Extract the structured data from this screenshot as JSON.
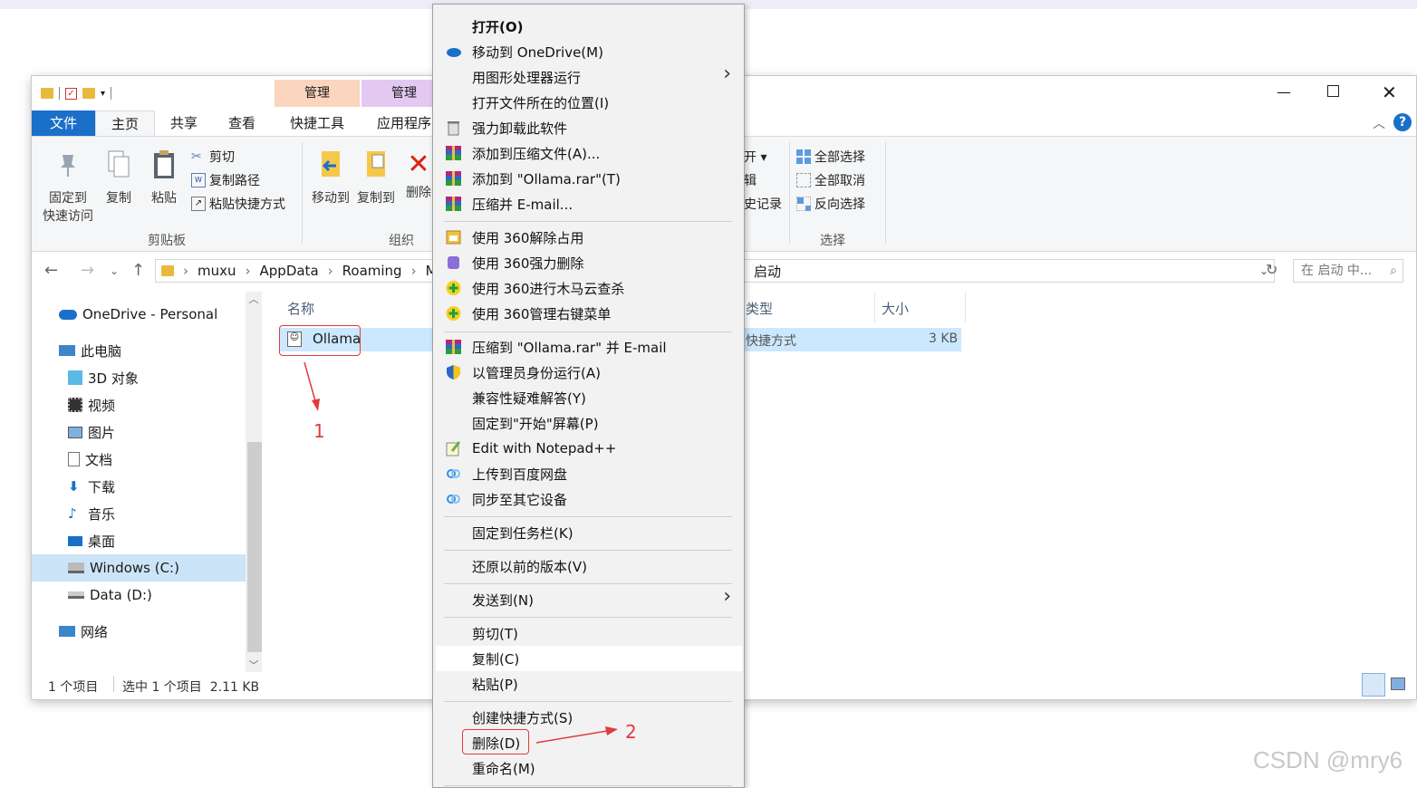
{
  "explorer": {
    "context_tabs": [
      "管理",
      "管理"
    ],
    "tabs": {
      "file": "文件",
      "home": "主页",
      "share": "共享",
      "view": "查看",
      "shortcut_tools": "快捷工具",
      "app_tools": "应用程序"
    },
    "ribbon": {
      "pin": [
        "固定到",
        "快速访问"
      ],
      "copy": "复制",
      "paste": "粘贴",
      "cut": "剪切",
      "copy_path": "复制路径",
      "paste_shortcut": "粘贴快捷方式",
      "clipboard_group": "剪贴板",
      "move_to": "移动到",
      "copy_to": "复制到",
      "delete": "删除",
      "organize_group": "组织",
      "open_partial": "开 ▾",
      "edit_partial": "辑",
      "history_partial": "史记录",
      "select_all": "全部选择",
      "select_none": "全部取消",
      "invert": "反向选择",
      "select_group": "选择"
    },
    "address": {
      "crumbs": [
        "muxu",
        "AppData",
        "Roaming",
        "M"
      ],
      "current": "启动",
      "search_placeholder": "在 启动 中..."
    },
    "nav": [
      "OneDrive - Personal",
      "此电脑",
      "3D 对象",
      "视频",
      "图片",
      "文档",
      "下载",
      "音乐",
      "桌面",
      "Windows (C:)",
      "Data (D:)",
      "网络"
    ],
    "columns": {
      "name": "名称",
      "type": "类型",
      "size": "大小"
    },
    "file": {
      "name": "Ollama",
      "type": "快捷方式",
      "size": "3 KB"
    },
    "status": {
      "count": "1 个项目",
      "selected": "选中 1 个项目  2.11 KB"
    }
  },
  "menu": {
    "items": [
      "打开(O)",
      "移动到 OneDrive(M)",
      "用图形处理器运行",
      "打开文件所在的位置(I)",
      "强力卸载此软件",
      "添加到压缩文件(A)...",
      "添加到 \"Ollama.rar\"(T)",
      "压缩并 E-mail...",
      "使用 360解除占用",
      "使用 360强力删除",
      "使用 360进行木马云查杀",
      "使用 360管理右键菜单",
      "压缩到 \"Ollama.rar\" 并 E-mail",
      "以管理员身份运行(A)",
      "兼容性疑难解答(Y)",
      "固定到\"开始\"屏幕(P)",
      "Edit with Notepad++",
      "上传到百度网盘",
      "同步至其它设备",
      "固定到任务栏(K)",
      "还原以前的版本(V)",
      "发送到(N)",
      "剪切(T)",
      "复制(C)",
      "粘贴(P)",
      "创建快捷方式(S)",
      "删除(D)",
      "重命名(M)"
    ]
  },
  "annotations": {
    "step1": "1",
    "step2": "2"
  },
  "watermark": "CSDN @mry6"
}
